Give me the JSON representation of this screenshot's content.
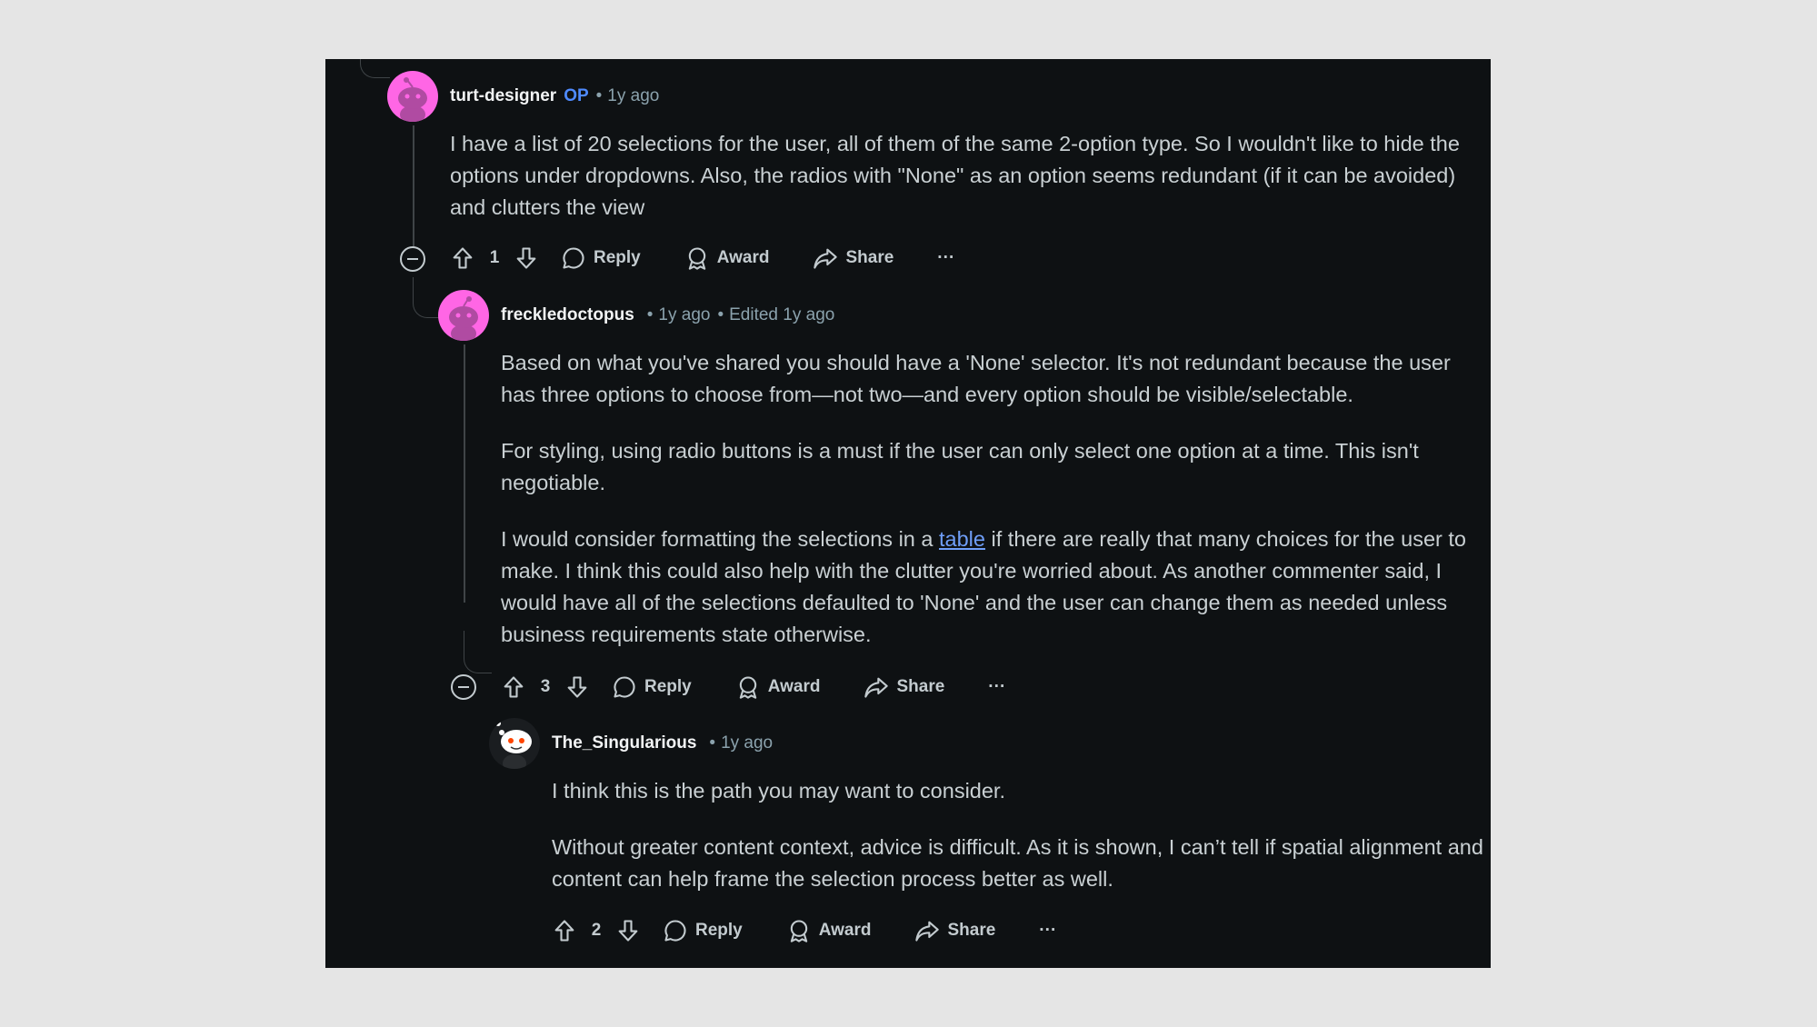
{
  "comments": [
    {
      "author": "turt-designer",
      "op_badge": "OP",
      "time": "1y ago",
      "edited": "",
      "avatar_icon": "snoo-pink-avatar-icon",
      "body": [
        "I have a list of 20 selections for the user, all of them of the same 2-option type. So I wouldn't like to hide the options under dropdowns. Also, the radios with \"None\" as an option seems redundant (if it can be avoided) and clutters the view"
      ],
      "votes": "1",
      "reply": "Reply",
      "award": "Award",
      "share": "Share",
      "more": "···"
    },
    {
      "author": "freckledoctopus",
      "op_badge": "",
      "time": "1y ago",
      "edited": "Edited 1y ago",
      "avatar_icon": "snoo-pink-avatar-icon",
      "body": [
        "Based on what you've shared you should have a 'None' selector. It's not redundant because the user has three options to choose from—not two—and every option should be visible/selectable.",
        "For styling, using radio buttons is a must if the user can only select one option at a time. This isn't negotiable."
      ],
      "body_link_paragraph": {
        "before": "I would consider formatting the selections in a ",
        "link": "table",
        "after": " if there are really that many choices for the user to make. I think this could also help with the clutter you're worried about. As another commenter said, I would have all of the selections defaulted to 'None' and the user can change them as needed unless business requirements state otherwise."
      },
      "votes": "3",
      "reply": "Reply",
      "award": "Award",
      "share": "Share",
      "more": "···"
    },
    {
      "author": "The_Singularious",
      "op_badge": "",
      "time": "1y ago",
      "edited": "",
      "avatar_icon": "snoo-white-avatar-icon",
      "body": [
        "I think this is the path you may want to consider.",
        "Without greater content context, advice is difficult. As it is shown, I can’t tell if spatial alignment and content can help frame the selection process better as well."
      ],
      "votes": "2",
      "reply": "Reply",
      "award": "Award",
      "share": "Share",
      "more": "···"
    }
  ],
  "colors": {
    "panel_bg": "#0e1113",
    "page_bg": "#e5e5e5",
    "author": "#f2f4f5",
    "op_badge": "#4f8bff",
    "meta": "#8ba2ad",
    "body_text": "#c9d0d3",
    "link": "#6f9ef8",
    "avatar_pink": "#ff66e5"
  }
}
